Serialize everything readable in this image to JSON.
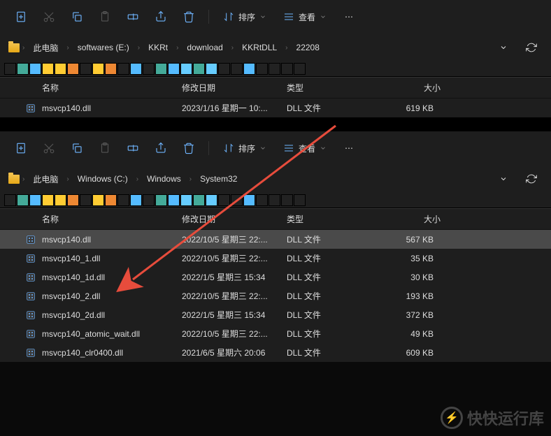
{
  "sort_label": "排序",
  "view_label": "查看",
  "cols": {
    "name": "名称",
    "date": "修改日期",
    "type": "类型",
    "size": "大小"
  },
  "win1": {
    "breadcrumb": [
      "此电脑",
      "softwares (E:)",
      "KKRt",
      "download",
      "KKRtDLL",
      "22208"
    ],
    "files": [
      {
        "name": "msvcp140.dll",
        "date": "2023/1/16 星期一 10:...",
        "type": "DLL 文件",
        "size": "619 KB"
      }
    ]
  },
  "win2": {
    "breadcrumb": [
      "此电脑",
      "Windows (C:)",
      "Windows",
      "System32"
    ],
    "files": [
      {
        "name": "msvcp140.dll",
        "date": "2022/10/5 星期三 22:...",
        "type": "DLL 文件",
        "size": "567 KB",
        "selected": true
      },
      {
        "name": "msvcp140_1.dll",
        "date": "2022/10/5 星期三 22:...",
        "type": "DLL 文件",
        "size": "35 KB"
      },
      {
        "name": "msvcp140_1d.dll",
        "date": "2022/1/5 星期三 15:34",
        "type": "DLL 文件",
        "size": "30 KB"
      },
      {
        "name": "msvcp140_2.dll",
        "date": "2022/10/5 星期三 22:...",
        "type": "DLL 文件",
        "size": "193 KB"
      },
      {
        "name": "msvcp140_2d.dll",
        "date": "2022/1/5 星期三 15:34",
        "type": "DLL 文件",
        "size": "372 KB"
      },
      {
        "name": "msvcp140_atomic_wait.dll",
        "date": "2022/10/5 星期三 22:...",
        "type": "DLL 文件",
        "size": "49 KB"
      },
      {
        "name": "msvcp140_clr0400.dll",
        "date": "2021/6/5 星期六 20:06",
        "type": "DLL 文件",
        "size": "609 KB"
      }
    ]
  },
  "watermark": "快快运行库"
}
